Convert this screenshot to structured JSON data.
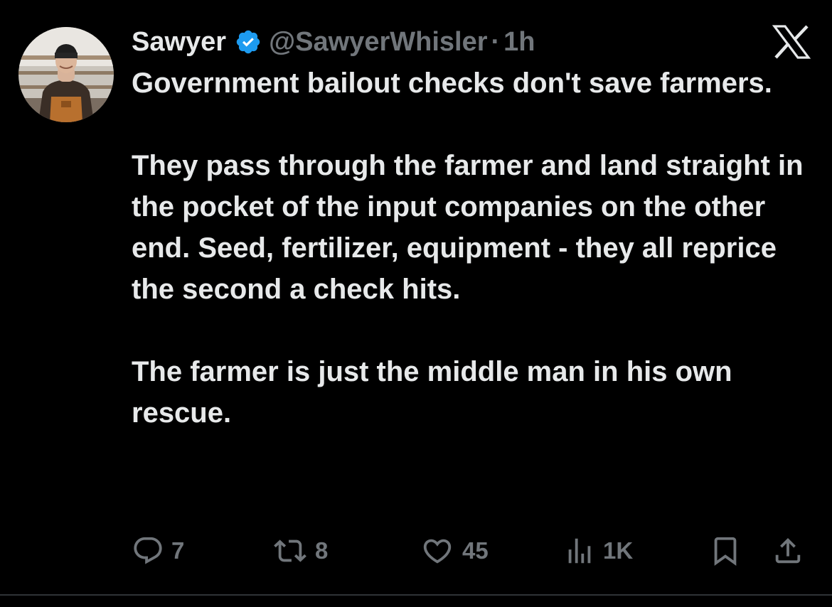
{
  "post": {
    "author": {
      "display_name": "Sawyer",
      "verified": true,
      "handle": "@SawyerWhisler",
      "separator": "·",
      "time": "1h",
      "avatar_icon": "avatar-photo"
    },
    "platform_icon": "x-logo-icon",
    "paragraphs": [
      "Government bailout checks don't save farmers.",
      "They pass through the farmer and land straight in the pocket of the input companies on the other end. Seed, fertilizer, equipment - they all reprice the second a check hits.",
      "The farmer is just the middle man in his own rescue."
    ],
    "actions": {
      "replies": {
        "icon": "reply-icon",
        "count": "7"
      },
      "reposts": {
        "icon": "repost-icon",
        "count": "8"
      },
      "likes": {
        "icon": "heart-icon",
        "count": "45"
      },
      "views": {
        "icon": "views-icon",
        "count": "1K"
      },
      "bookmark": {
        "icon": "bookmark-icon"
      },
      "share": {
        "icon": "share-icon"
      }
    }
  },
  "colors": {
    "background": "#000000",
    "text": "#e7e9ea",
    "muted": "#71767b",
    "verified_blue": "#1d9bf0"
  }
}
